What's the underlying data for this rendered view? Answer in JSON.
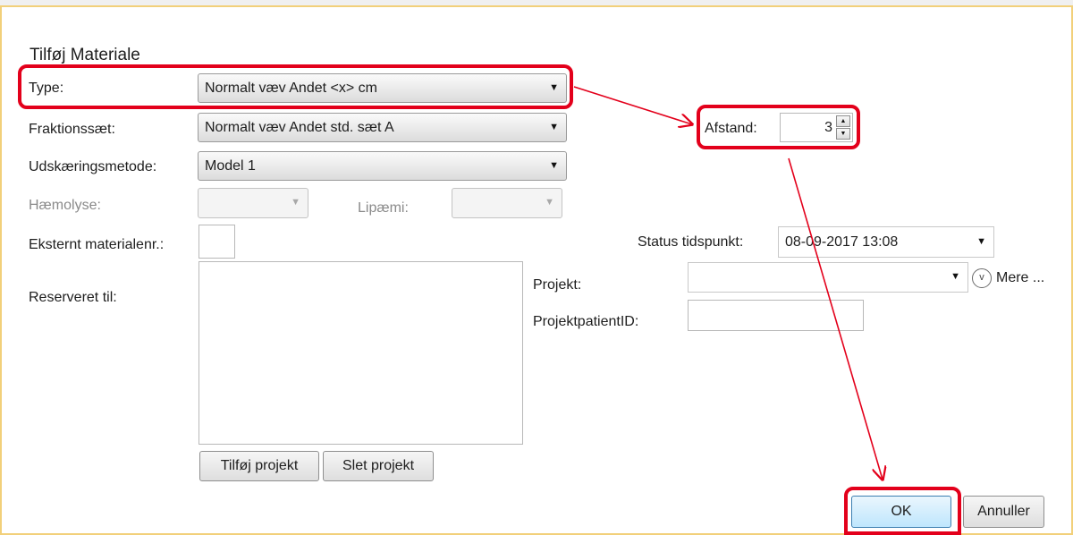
{
  "dialog": {
    "title": "Tilføj Materiale",
    "fields": {
      "type": {
        "label": "Type:",
        "value": "Normalt væv Andet <x> cm"
      },
      "fraktion": {
        "label": "Fraktionssæt:",
        "value": "Normalt væv Andet std. sæt A"
      },
      "udskaering": {
        "label": "Udskæringsmetode:",
        "value": "Model 1"
      },
      "haemolyse": {
        "label": "Hæmolyse:",
        "value": ""
      },
      "lipaemi": {
        "label": "Lipæmi:",
        "value": ""
      },
      "eksternt": {
        "label": "Eksternt materialenr.:",
        "value": ""
      },
      "reserveret": {
        "label": "Reserveret til:"
      },
      "afstand": {
        "label": "Afstand:",
        "value": "3"
      },
      "status": {
        "label": "Status tidspunkt:",
        "value": "08-09-2017 13:08"
      },
      "projekt": {
        "label": "Projekt:",
        "value": "",
        "more_label": "Mere ..."
      },
      "projektpatient": {
        "label": "ProjektpatientID:",
        "value": ""
      }
    },
    "buttons": {
      "add_project": "Tilføj projekt",
      "delete_project": "Slet projekt",
      "ok": "OK",
      "cancel": "Annuller"
    }
  },
  "icons": {
    "dropdown": "chevron-down-icon",
    "more": "circle-chevron-down-icon",
    "spin_up": "caret-up-icon",
    "spin_down": "caret-down-icon"
  },
  "annotation": {
    "color": "#e3001b"
  }
}
